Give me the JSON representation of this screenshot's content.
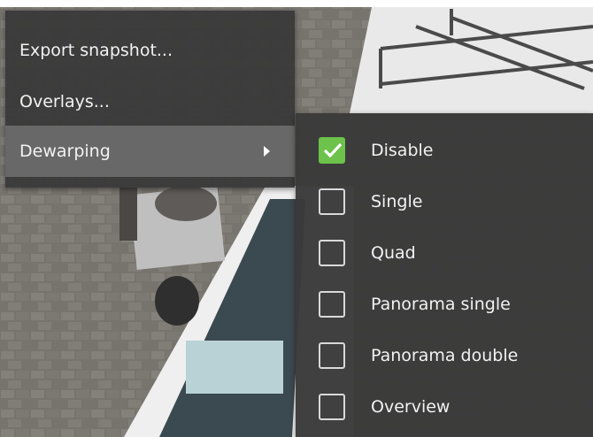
{
  "menu": {
    "items": [
      {
        "label": "Export snapshot..."
      },
      {
        "label": "Overlays..."
      },
      {
        "label": "Dewarping",
        "has_submenu": true,
        "highlighted": true
      }
    ]
  },
  "submenu": {
    "items": [
      {
        "label": "Disable",
        "checked": true
      },
      {
        "label": "Single",
        "checked": false
      },
      {
        "label": "Quad",
        "checked": false
      },
      {
        "label": "Panorama single",
        "checked": false
      },
      {
        "label": "Panorama double",
        "checked": false
      },
      {
        "label": "Overview",
        "checked": false
      }
    ]
  },
  "colors": {
    "menu_bg": "#3a3a3a",
    "highlight": "#686868",
    "check_accent": "#6cc24a",
    "text": "#f2f2f2"
  },
  "icons": {
    "submenu_arrow": "triangle-right-icon",
    "check": "checkmark-icon"
  }
}
